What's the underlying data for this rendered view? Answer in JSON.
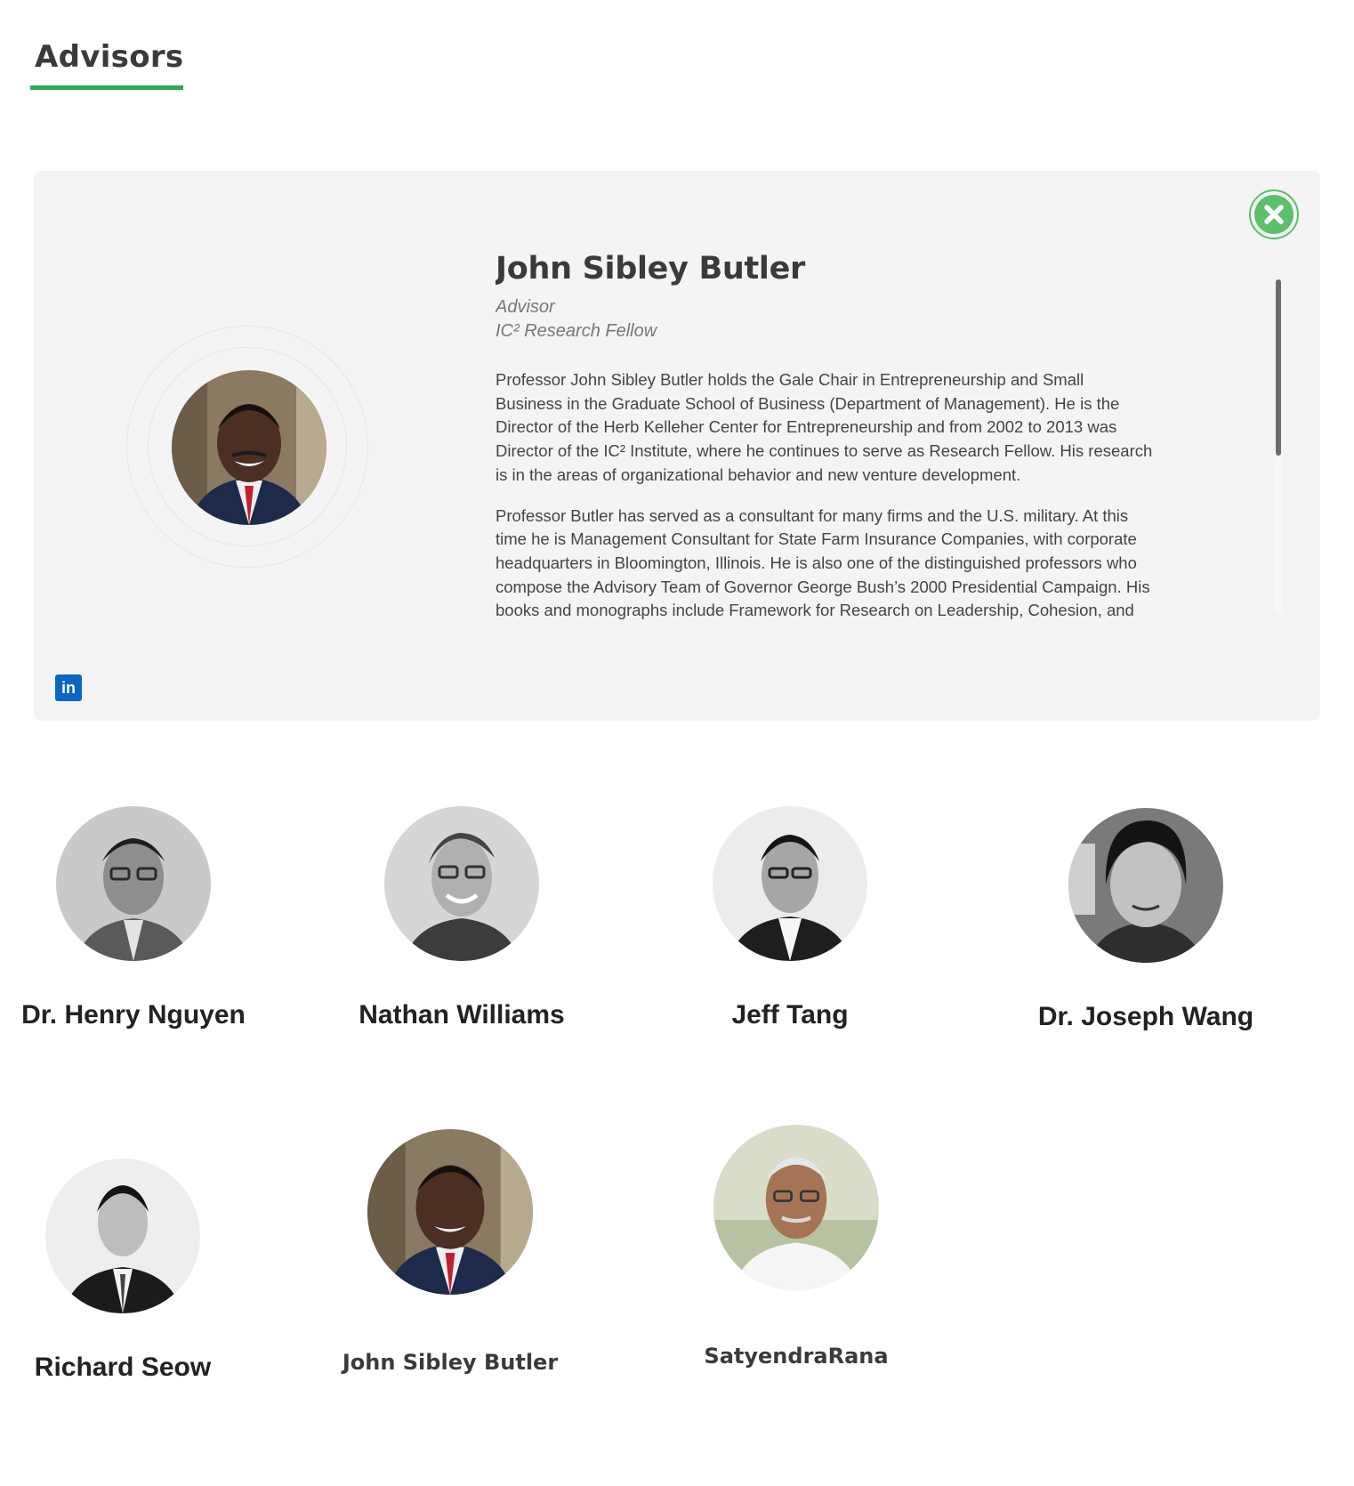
{
  "section": {
    "title": "Advisors"
  },
  "detail": {
    "name": "John Sibley Butler",
    "role": "Advisor",
    "subrole": "IC² Research Fellow",
    "bio": [
      "Professor John Sibley Butler holds the Gale Chair in Entrepreneurship and Small Business in the Graduate School of Business (Department of Management). He is the Director of the Herb Kelleher Center for Entrepreneurship and from 2002 to 2013 was Director of the IC² Institute, where he continues to serve as Research Fellow. His research is in the areas of organizational behavior and new venture development.",
      "Professor Butler has served as a consultant for many firms and the U.S. military. At this time he is Management Consultant for State Farm Insurance Companies, with corporate headquarters in Bloomington, Illinois. He is also one of the distinguished professors who compose the Advisory Team of Governor George Bush’s 2000 Presidential Campaign. His books and monographs include Framework for Research on Leadership, Cohesion, and Values: Entrepreneurship and Self-Help Among Black Americans: A Reconsideration of Race"
    ],
    "close_icon": "close-icon",
    "linkedin_label": "in"
  },
  "advisors": [
    {
      "name": "Dr. Henry Nguyen"
    },
    {
      "name": "Nathan Williams"
    },
    {
      "name": "Jeff Tang"
    },
    {
      "name": "Dr. Joseph Wang"
    },
    {
      "name": "Richard Seow"
    },
    {
      "name": "John Sibley Butler"
    },
    {
      "name": "SatyendraRana"
    }
  ],
  "colors": {
    "accent": "#2eaa4a",
    "close": "#5cbf6a",
    "linkedin": "#0a66c2",
    "panel": "#f4f4f4"
  }
}
